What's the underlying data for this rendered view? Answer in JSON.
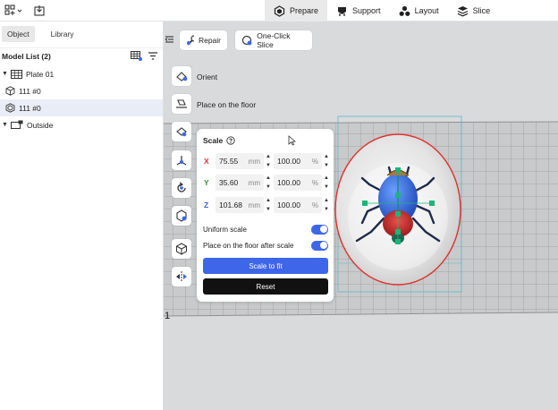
{
  "topbar": {
    "stages": [
      {
        "label": "Prepare",
        "icon": "prepare-cube-icon",
        "active": true
      },
      {
        "label": "Support",
        "icon": "support-icon",
        "active": false
      },
      {
        "label": "Layout",
        "icon": "layout-icon",
        "active": false
      },
      {
        "label": "Slice",
        "icon": "slice-layers-icon",
        "active": false
      }
    ]
  },
  "sidebar": {
    "tabs": [
      {
        "label": "Object",
        "active": true
      },
      {
        "label": "Library",
        "active": false
      }
    ],
    "model_list_title": "Model List (2)",
    "tree": [
      {
        "label": "Plate 01"
      },
      {
        "label": "111 #0"
      },
      {
        "label": "111 #0"
      },
      {
        "label": "Outside"
      }
    ]
  },
  "toolbar": {
    "repair_label": "Repair",
    "one_click_slice_label": "One-Click Slice"
  },
  "tools": {
    "orient_label": "Orient",
    "place_floor_label": "Place on the floor"
  },
  "scale_panel": {
    "title": "Scale",
    "rows": [
      {
        "axis": "X",
        "size": "75.55",
        "unit": "mm",
        "percent": "100.00",
        "pct_unit": "%",
        "color": "#e0302c"
      },
      {
        "axis": "Y",
        "size": "35.60",
        "unit": "mm",
        "percent": "100.00",
        "pct_unit": "%",
        "color": "#2a9a2a"
      },
      {
        "axis": "Z",
        "size": "101.68",
        "unit": "mm",
        "percent": "100.00",
        "pct_unit": "%",
        "color": "#3b63d8"
      }
    ],
    "uniform_scale_label": "Uniform scale",
    "uniform_scale_on": true,
    "place_floor_after_scale_label": "Place on the floor after scale",
    "place_floor_after_scale_on": true,
    "scale_to_fit_label": "Scale to fit",
    "reset_label": "Reset"
  },
  "viewport": {
    "plate_label": "1"
  },
  "colors": {
    "accent": "#3e66e8",
    "dark_button": "#111111",
    "plate": "#c8cacb",
    "background": "#d8dadc"
  }
}
